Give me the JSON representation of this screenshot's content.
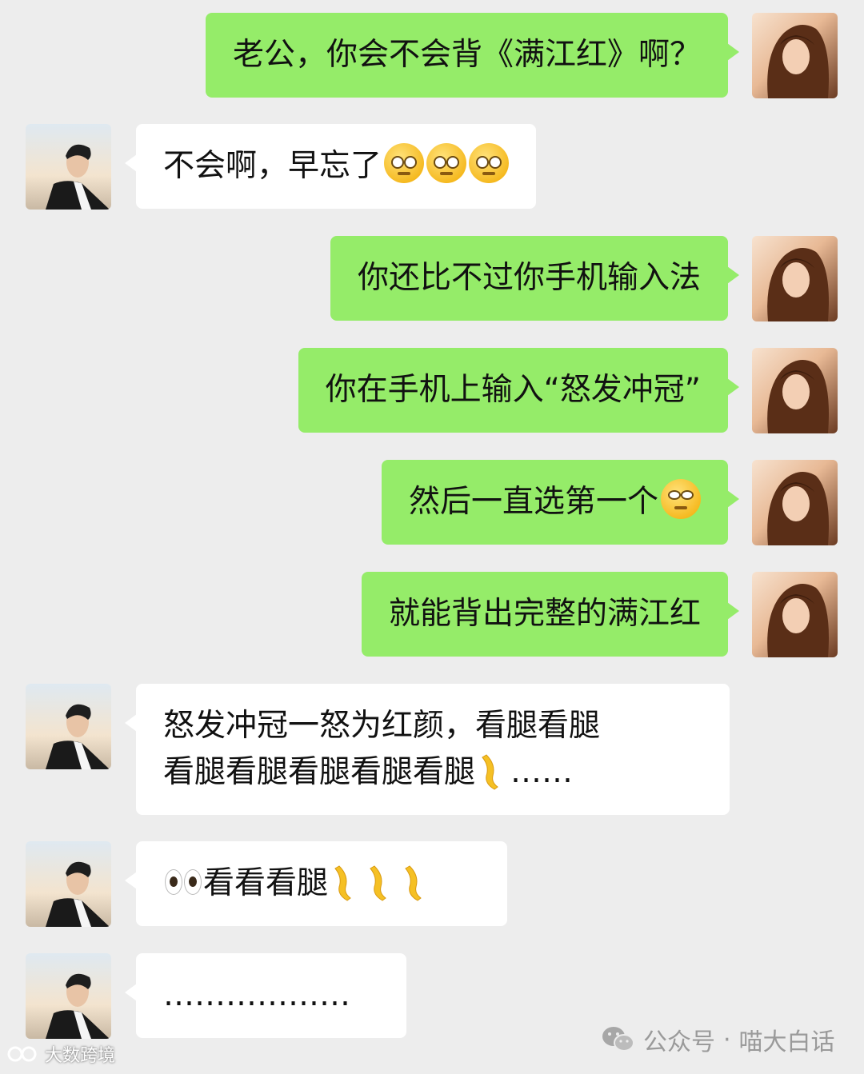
{
  "messages": [
    {
      "sender": "her",
      "type": "out",
      "text": "老公，你会不会背《满江红》啊？"
    },
    {
      "sender": "him",
      "type": "in",
      "text": "不会啊，早忘了",
      "emoji": [
        "pleading-face",
        "pleading-face",
        "pleading-face"
      ]
    },
    {
      "sender": "her",
      "type": "out",
      "text": "你还比不过你手机输入法"
    },
    {
      "sender": "her",
      "type": "out",
      "text": "你在手机上输入“怒发冲冠”"
    },
    {
      "sender": "her",
      "type": "out",
      "text": "然后一直选第一个",
      "emoji": [
        "rolling-eyes-face"
      ]
    },
    {
      "sender": "her",
      "type": "out",
      "text": "就能背出完整的满江红"
    },
    {
      "sender": "him",
      "type": "in",
      "line1": "怒发冲冠一怒为红颜，看腿看腿",
      "line2": "看腿看腿看腿看腿看腿",
      "line2_suffix": "……"
    },
    {
      "sender": "him",
      "type": "in",
      "text": "看看看腿"
    },
    {
      "sender": "him",
      "type": "in",
      "text": "………………"
    }
  ],
  "watermarks": {
    "left": "大数跨境",
    "right_prefix": "公众号",
    "right_separator": "·",
    "right_name": "喵大白话"
  },
  "colors": {
    "outgoing_bubble": "#95ec69",
    "incoming_bubble": "#ffffff",
    "background": "#ededed"
  }
}
